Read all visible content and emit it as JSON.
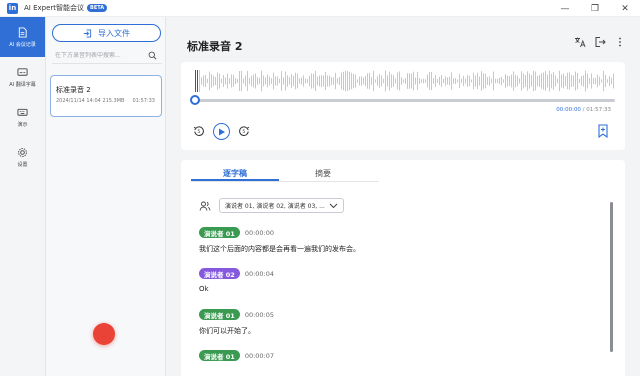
{
  "app": {
    "title": "AI Expert智能会议",
    "badge": "BETA",
    "logo_text": "in",
    "window_controls": {
      "minimize": "—",
      "restore": "❐",
      "close": "✕"
    }
  },
  "nav": {
    "items": [
      {
        "label": "AI 会议记录",
        "icon": "document-icon",
        "active": true
      },
      {
        "label": "AI 翻译字幕",
        "icon": "subtitle-icon",
        "active": false
      },
      {
        "label": "演示",
        "icon": "keyboard-icon",
        "active": false
      },
      {
        "label": "设置",
        "icon": "gear-icon",
        "active": false
      }
    ]
  },
  "list": {
    "import_label": "导入文件",
    "search_placeholder": "在下方录音列表中搜索...",
    "recordings": [
      {
        "title": "标准录音 2",
        "meta": "2024/11/14 14:04  215.3MB",
        "duration": "01:57:33"
      }
    ]
  },
  "main": {
    "title": "标准录音 2",
    "header_icons": [
      "translate-icon",
      "export-icon",
      "more-icon"
    ]
  },
  "player": {
    "current_time": "00:00:00",
    "separator": " / ",
    "total_time": "01:57:33",
    "progress": 0
  },
  "transcript": {
    "tabs": [
      {
        "label": "逐字稿",
        "active": true
      },
      {
        "label": "摘要",
        "active": false
      }
    ],
    "speaker_filter": "演说者 01, 演说者 02, 演说者 03, ...",
    "segments": [
      {
        "speaker": "演说者 01",
        "time": "00:00:00",
        "text": "我们这个后面的内容都是会再看一遍我们的发布会。",
        "color": "#3b9a52"
      },
      {
        "speaker": "演说者 02",
        "time": "00:00:04",
        "text": "Ok",
        "color": "#8559de"
      },
      {
        "speaker": "演说者 01",
        "time": "00:00:05",
        "text": "你们可以开始了。",
        "color": "#3b9a52"
      },
      {
        "speaker": "演说者 01",
        "time": "00:00:07",
        "text": "",
        "color": "#3b9a52"
      }
    ]
  },
  "colors": {
    "accent": "#2f6fd6",
    "record": "#e94236",
    "speaker1": "#3b9a52",
    "speaker2": "#8559de"
  }
}
